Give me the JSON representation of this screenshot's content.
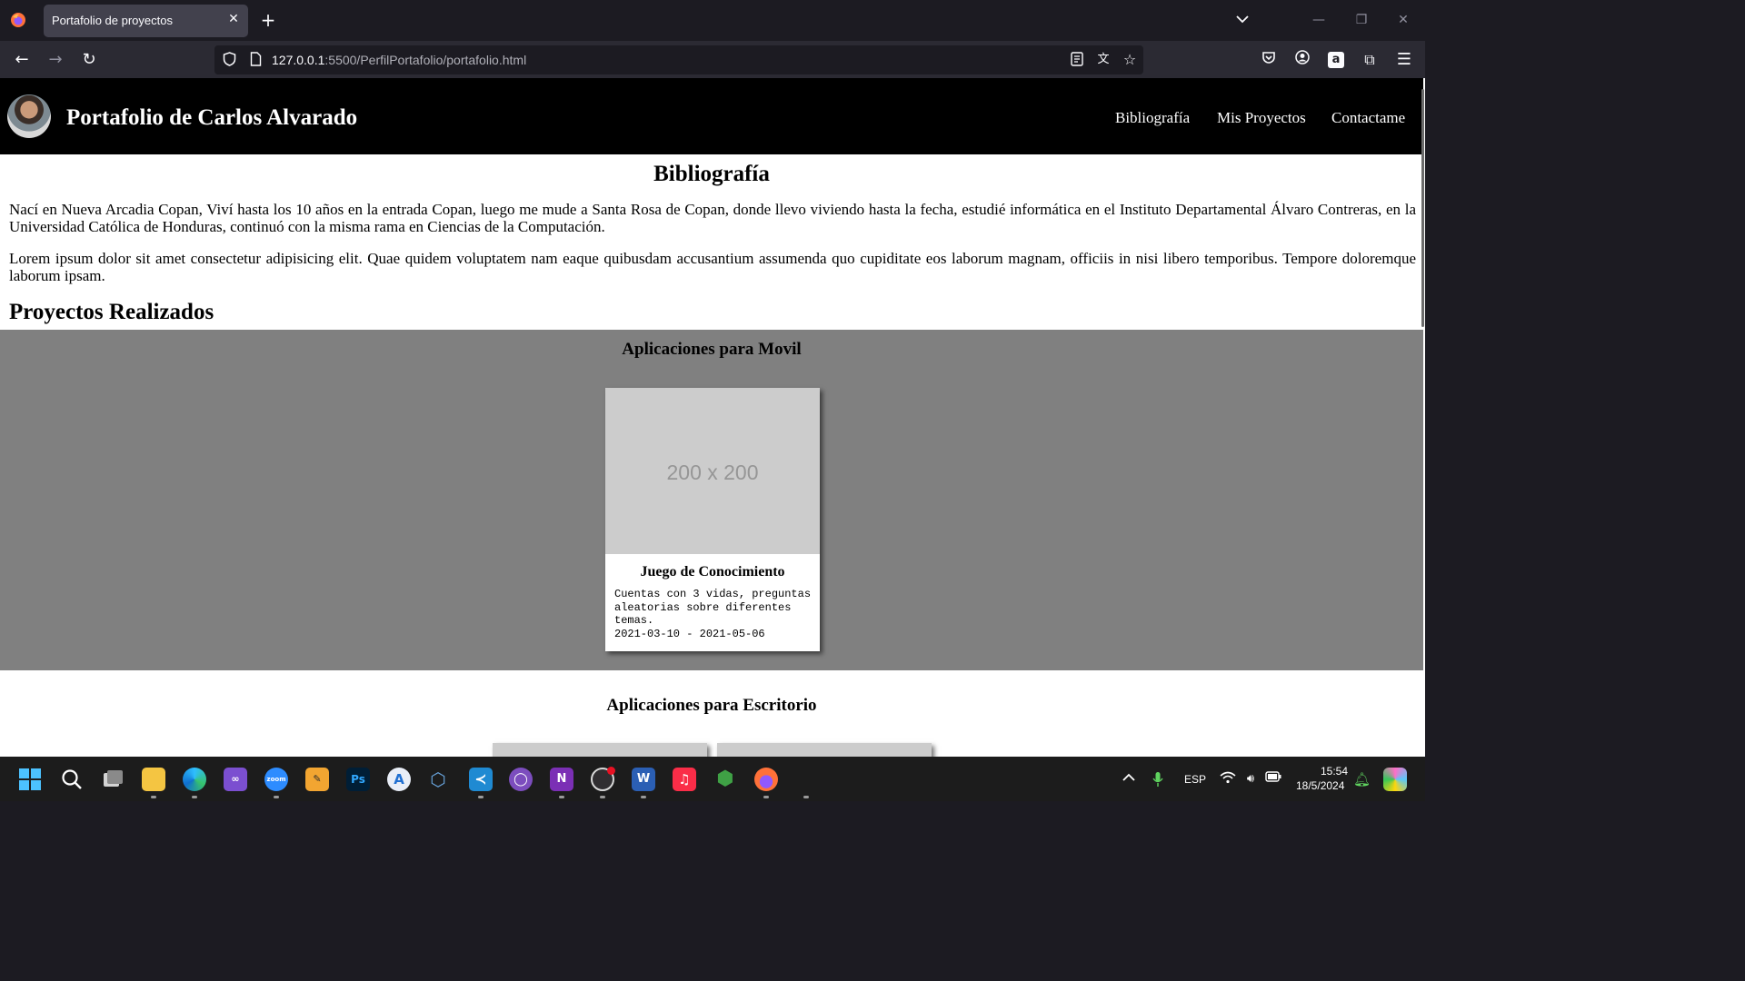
{
  "browser": {
    "tab_title": "Portafolio de proyectos",
    "url_host": "127.0.0.1",
    "url_path": ":5500/PerfilPortafolio/portafolio.html",
    "icons": [
      "firefox-icon",
      "close-icon",
      "plus-icon",
      "chevron-down-icon",
      "minimize-icon",
      "restore-icon",
      "window-close-icon",
      "back-icon",
      "forward-icon",
      "reload-icon",
      "shield-icon",
      "page-icon",
      "reader-view-icon",
      "translate-icon",
      "star-icon",
      "pocket-icon",
      "account-icon",
      "amazon-icon",
      "extensions-icon",
      "menu-icon"
    ]
  },
  "site": {
    "title": "Portafolio de Carlos Alvarado",
    "nav": [
      "Bibliografía",
      "Mis Proyectos",
      "Contactame"
    ]
  },
  "bio": {
    "heading": "Bibliografía",
    "paragraph_1": "Nací en Nueva Arcadia Copan, Viví hasta los 10 años en la entrada Copan, luego me mude a Santa Rosa de Copan, donde llevo viviendo hasta la fecha, estudié informática en el Instituto Departamental Álvaro Contreras, en la Universidad Católica de Honduras, continuó con la misma rama en Ciencias de la Computación.",
    "paragraph_2": "Lorem ipsum dolor sit amet consectetur adipisicing elit. Quae quidem voluptatem nam eaque quibusdam accusantium assumenda quo cupiditate eos laborum magnam, officiis in nisi libero temporibus. Tempore doloremque laborum ipsam."
  },
  "projects": {
    "heading": "Proyectos Realizados",
    "mobile": {
      "title": "Aplicaciones para Movil",
      "card": {
        "image_text": "200 x 200",
        "title": "Juego de Conocimiento",
        "description": "Cuentas con 3 vidas, preguntas aleatorias sobre diferentes temas.",
        "dates": "2021-03-10 - 2021-05-06"
      }
    },
    "desktop": {
      "title": "Aplicaciones para Escritorio"
    }
  },
  "taskbar": {
    "apps": [
      "windows-start",
      "search",
      "task-view",
      "file-explorer",
      "edge",
      "visual-studio",
      "zoom",
      "app-tool",
      "photoshop",
      "app-store",
      "virtualbox",
      "vscode",
      "github-desktop",
      "onenote",
      "obs",
      "word",
      "itunes",
      "node",
      "firefox"
    ],
    "zoom_label": "zoom",
    "ps_label": "Ps",
    "language": "ESP",
    "time": "15:54",
    "date": "18/5/2024"
  }
}
